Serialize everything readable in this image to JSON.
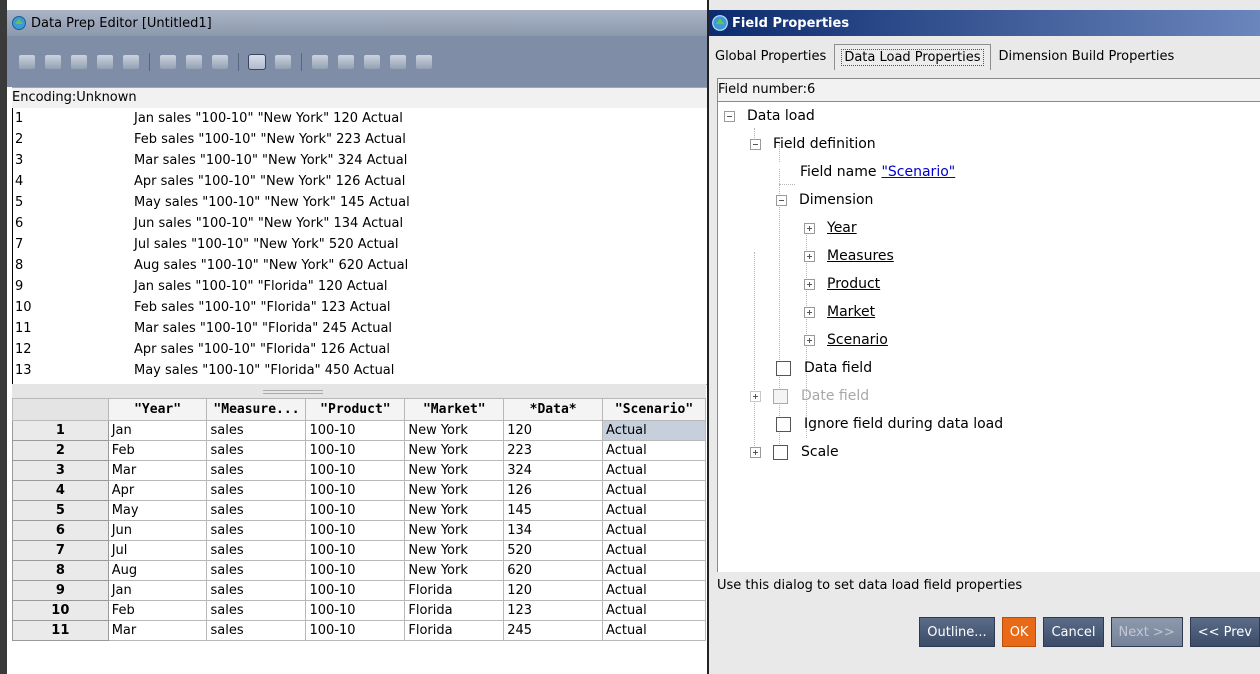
{
  "editor": {
    "title": "Data Prep Editor [Untitled1]",
    "toolbar_icons": [
      "open-icon",
      "save-icon",
      "filter-icon",
      "add-icon",
      "text-icon",
      "sep",
      "edit-icon",
      "join-icon",
      "delete-icon",
      "sep",
      "field-properties-icon",
      "edit-field-icon",
      "sep",
      "dimension-icon",
      "edit-dim-icon",
      "move-icon",
      "rename-icon",
      "split-icon"
    ],
    "encoding": "Encoding:Unknown",
    "raw_lines": [
      {
        "n": "1",
        "text": "Jan sales \"100-10\" \"New York\" 120 Actual"
      },
      {
        "n": "2",
        "text": "Feb sales \"100-10\" \"New York\" 223 Actual"
      },
      {
        "n": "3",
        "text": "Mar sales \"100-10\" \"New York\" 324 Actual"
      },
      {
        "n": "4",
        "text": "Apr sales \"100-10\" \"New York\" 126 Actual"
      },
      {
        "n": "5",
        "text": "May sales \"100-10\" \"New York\" 145 Actual"
      },
      {
        "n": "6",
        "text": "Jun sales \"100-10\" \"New York\" 134 Actual"
      },
      {
        "n": "7",
        "text": "Jul sales \"100-10\" \"New York\" 520 Actual"
      },
      {
        "n": "8",
        "text": "Aug sales \"100-10\" \"New York\" 620 Actual"
      },
      {
        "n": "9",
        "text": "Jan sales \"100-10\" \"Florida\" 120 Actual"
      },
      {
        "n": "10",
        "text": "Feb sales \"100-10\" \"Florida\" 123 Actual"
      },
      {
        "n": "11",
        "text": "Mar sales \"100-10\" \"Florida\" 245 Actual"
      },
      {
        "n": "12",
        "text": "Apr sales \"100-10\" \"Florida\" 126 Actual"
      },
      {
        "n": "13",
        "text": "May sales \"100-10\" \"Florida\" 450 Actual"
      }
    ],
    "grid": {
      "headers": [
        "\"Year\"",
        "\"Measure...",
        "\"Product\"",
        "\"Market\"",
        "*Data*",
        "\"Scenario\""
      ],
      "rows": [
        {
          "n": "1",
          "cells": [
            "Jan",
            "sales",
            "100-10",
            "New York",
            "120",
            "Actual"
          ]
        },
        {
          "n": "2",
          "cells": [
            "Feb",
            "sales",
            "100-10",
            "New York",
            "223",
            "Actual"
          ]
        },
        {
          "n": "3",
          "cells": [
            "Mar",
            "sales",
            "100-10",
            "New York",
            "324",
            "Actual"
          ]
        },
        {
          "n": "4",
          "cells": [
            "Apr",
            "sales",
            "100-10",
            "New York",
            "126",
            "Actual"
          ]
        },
        {
          "n": "5",
          "cells": [
            "May",
            "sales",
            "100-10",
            "New York",
            "145",
            "Actual"
          ]
        },
        {
          "n": "6",
          "cells": [
            "Jun",
            "sales",
            "100-10",
            "New York",
            "134",
            "Actual"
          ]
        },
        {
          "n": "7",
          "cells": [
            "Jul",
            "sales",
            "100-10",
            "New York",
            "520",
            "Actual"
          ]
        },
        {
          "n": "8",
          "cells": [
            "Aug",
            "sales",
            "100-10",
            "New York",
            "620",
            "Actual"
          ]
        },
        {
          "n": "9",
          "cells": [
            "Jan",
            "sales",
            "100-10",
            "Florida",
            "120",
            "Actual"
          ]
        },
        {
          "n": "10",
          "cells": [
            "Feb",
            "sales",
            "100-10",
            "Florida",
            "123",
            "Actual"
          ]
        },
        {
          "n": "11",
          "cells": [
            "Mar",
            "sales",
            "100-10",
            "Florida",
            "245",
            "Actual"
          ]
        }
      ]
    }
  },
  "props": {
    "title": "Field Properties",
    "tabs": [
      "Global Properties",
      "Data Load Properties",
      "Dimension Build Properties"
    ],
    "field_number": "Field number:6",
    "tree": {
      "data_load": "Data load",
      "field_definition": "Field definition",
      "field_name_label": "Field name",
      "field_name_value": "\"Scenario\"",
      "dimension": "Dimension",
      "dimensions": [
        "Year",
        "Measures",
        "Product",
        "Market",
        "Scenario"
      ],
      "data_field": "Data field",
      "date_field": "Date field",
      "ignore_field": "Ignore field during data load",
      "scale": "Scale"
    },
    "help_text": "Use this dialog to set data load field properties",
    "buttons": {
      "outline": "Outline...",
      "ok": "OK",
      "cancel": "Cancel",
      "next": "Next >>",
      "prev": "<< Prev"
    }
  },
  "colors": {
    "accent_ok": "#e86a18",
    "title_bar": "#0c2b6e",
    "toolbar": "#7f8da6"
  }
}
